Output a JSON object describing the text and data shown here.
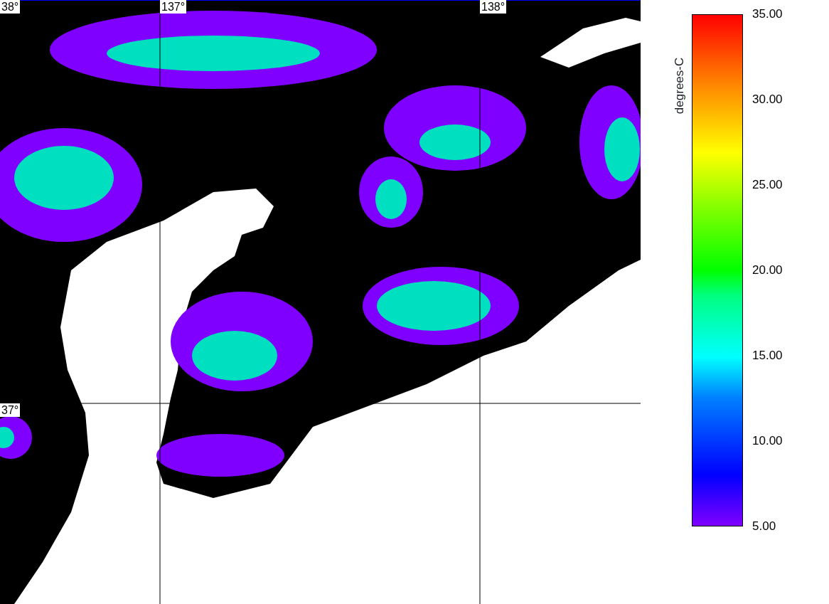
{
  "map": {
    "lat_labels": [
      "38°",
      "37°"
    ],
    "lon_labels": [
      "137°",
      "138°"
    ]
  },
  "colorbar": {
    "title": "degrees-C",
    "ticks": [
      "35.00",
      "30.00",
      "25.00",
      "20.00",
      "15.00",
      "10.00",
      "5.00"
    ]
  }
}
